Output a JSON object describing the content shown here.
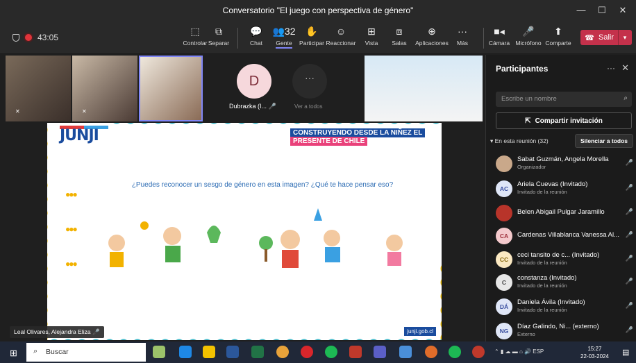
{
  "window": {
    "title": "Conversatorio \"El juego con perspectiva de género\"",
    "minimize": "—",
    "maximize": "☐",
    "close": "✕"
  },
  "toolbar": {
    "timer": "43:05",
    "buttons": [
      {
        "label": "Controlar",
        "icon": "screen-control-icon",
        "glyph": "⬚"
      },
      {
        "label": "Separar",
        "icon": "pop-out-icon",
        "glyph": "⧉"
      },
      {
        "label": "Chat",
        "icon": "chat-icon",
        "glyph": "💬"
      },
      {
        "label": "Gente",
        "icon": "people-icon",
        "glyph": "👥32"
      },
      {
        "label": "Participar",
        "icon": "raise-hand-icon",
        "glyph": "✋"
      },
      {
        "label": "Reaccionar",
        "icon": "smile-icon",
        "glyph": "☺"
      },
      {
        "label": "Vista",
        "icon": "view-icon",
        "glyph": "⊞"
      },
      {
        "label": "Salas",
        "icon": "rooms-icon",
        "glyph": "⧈"
      },
      {
        "label": "Aplicaciones",
        "icon": "apps-icon",
        "glyph": "⊕"
      },
      {
        "label": "Más",
        "icon": "more-icon",
        "glyph": "···"
      },
      {
        "label": "Cámara",
        "icon": "camera-icon",
        "glyph": "■◂"
      },
      {
        "label": "Micrófono",
        "icon": "mic-off-icon",
        "glyph": "🎤"
      },
      {
        "label": "Comparte",
        "icon": "share-icon",
        "glyph": "⬆"
      }
    ],
    "leave_label": "Salir"
  },
  "stage": {
    "tile_d_initial": "D",
    "tile_d_name": "Dubrazka (I...",
    "see_all": "Ver a todos",
    "more_dots": "···",
    "speaker_label": "Leal Olivares, Alejandra Eliza"
  },
  "slide": {
    "logo": "JUNJI",
    "banner_line1": "CONSTRUYENDO DESDE LA NIÑEZ EL",
    "banner_line2": "PRESENTE DE CHILE",
    "question": "¿Puedes reconocer un sesgo de género en esta imagen? ¿Qué te hace pensar eso?",
    "url": "junji.gob.cl"
  },
  "panel": {
    "title": "Participantes",
    "search_placeholder": "Escribe un nombre",
    "invite_label": "Compartir invitación",
    "section_label": "En esta reunión (32)",
    "silence_label": "Silenciar a todos",
    "participants": [
      {
        "initials": "",
        "name": "Sabat Guzmán, Angela Morella",
        "role": "Organizador",
        "color": "#c9a88a"
      },
      {
        "initials": "AC",
        "name": "Ariela Cuevas (Invitado)",
        "role": "Invitado de la reunión",
        "color": "#dfe6f7"
      },
      {
        "initials": "",
        "name": "Belen Abigail Pulgar Jaramillo",
        "role": "",
        "color": "#b8342a"
      },
      {
        "initials": "CA",
        "name": "Cardenas Villablanca Vanessa Al...",
        "role": "",
        "color": "#f4c9cc"
      },
      {
        "initials": "CC",
        "name": "ceci tansito de c... (Invitado)",
        "role": "Invitado de la reunión",
        "color": "#fbe9c2"
      },
      {
        "initials": "C",
        "name": "constanza (Invitado)",
        "role": "Invitado de la reunión",
        "color": "#e7e7e7"
      },
      {
        "initials": "DÁ",
        "name": "Daniela Ávila (Invitado)",
        "role": "Invitado de la reunión",
        "color": "#dfe6f7"
      },
      {
        "initials": "NG",
        "name": "Díaz Galindo, Ni... (externo)",
        "role": "Externo",
        "color": "#dfe6f7"
      }
    ]
  },
  "taskbar": {
    "search_label": "Buscar",
    "tray_lang": "ESP",
    "time": "15:27",
    "date": "22-03-2024"
  }
}
